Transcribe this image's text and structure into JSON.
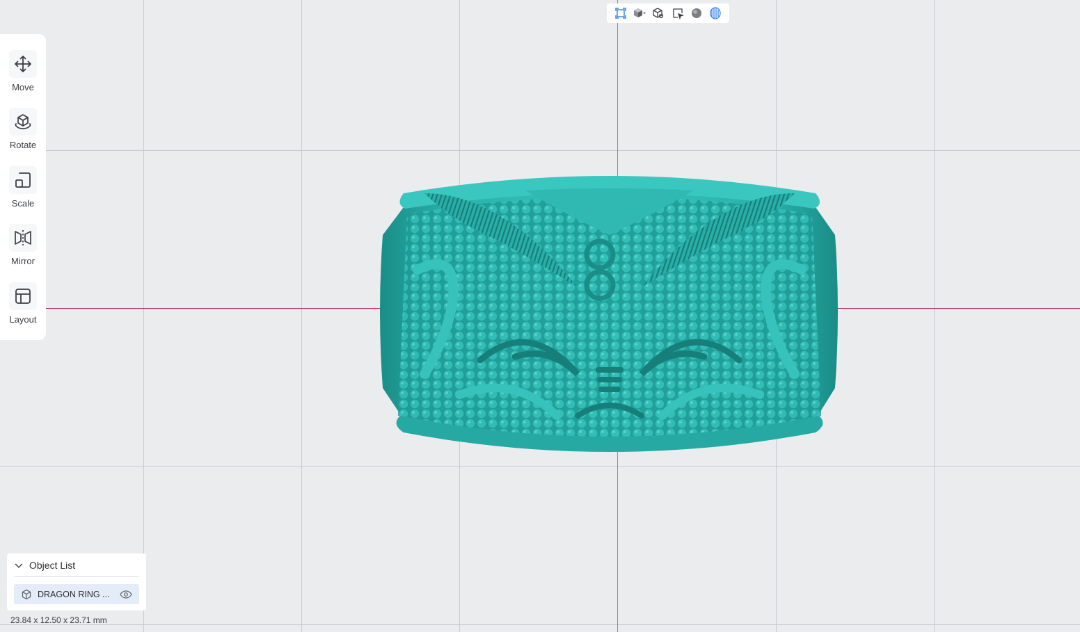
{
  "toolbar": {
    "items": [
      {
        "label": "Move",
        "icon": "move-icon"
      },
      {
        "label": "Rotate",
        "icon": "rotate-icon"
      },
      {
        "label": "Scale",
        "icon": "scale-icon"
      },
      {
        "label": "Mirror",
        "icon": "mirror-icon"
      },
      {
        "label": "Layout",
        "icon": "layout-icon"
      }
    ]
  },
  "view_bar": {
    "icons": [
      "fit-view-icon",
      "standard-views-icon",
      "iso-view-icon",
      "select-view-icon",
      "material-sphere-icon",
      "xray-view-icon"
    ]
  },
  "object_list": {
    "title": "Object List",
    "items": [
      {
        "name": "DRAGON RING ...",
        "icon": "cube-icon",
        "visibility_icon": "eye-icon"
      }
    ]
  },
  "dimensions": "23.84 x 12.50 x 23.71 mm",
  "colors": {
    "model": "#2bb4ad",
    "accent": "#2f80ed",
    "axis_x": "#c2185b",
    "axis_y": "#35c85a",
    "background": "#ebecee"
  }
}
